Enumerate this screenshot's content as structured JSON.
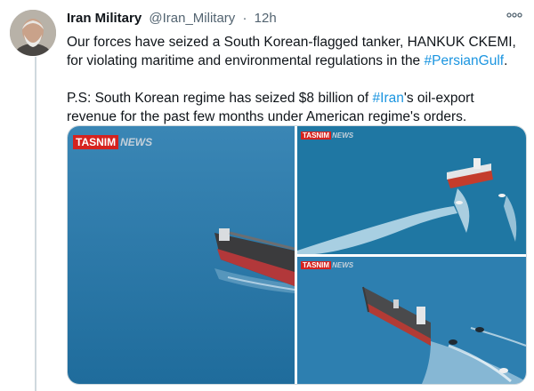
{
  "tweet": {
    "display_name": "Iran Military",
    "handle": "@Iran_Military",
    "separator": "·",
    "time": "12h",
    "text_part1": "Our forces have seized a South Korean-flagged tanker, HANKUK CKEMI, for violating maritime and environmental regulations in the ",
    "hashtag1": "#PersianGulf",
    "text_part2": ".",
    "ps_part1": "P.S:  South Korean regime has seized $8 billion of ",
    "hashtag2": "#Iran",
    "ps_part2": "'s oil-export revenue for the past few months under American regime's orders."
  },
  "media": {
    "watermark_brand": "TASNIM",
    "watermark_suffix": "NEWS"
  },
  "icons": {
    "more": "more-options-icon"
  },
  "colors": {
    "link": "#1b95e0",
    "sea": "#2a7aa8",
    "watermark_red": "#d5231f"
  }
}
